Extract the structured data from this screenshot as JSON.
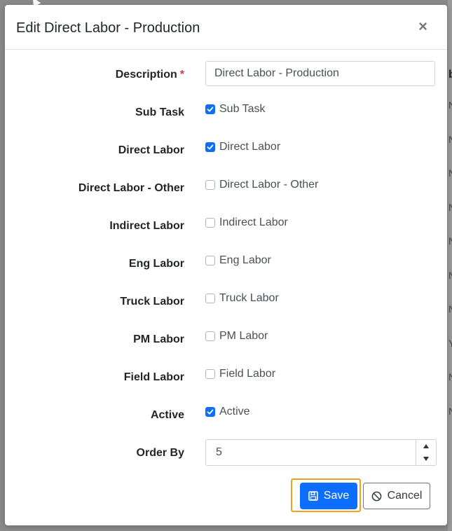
{
  "modal": {
    "title": "Edit Direct Labor - Production",
    "close_glyph": "×"
  },
  "fields": {
    "description": {
      "label": "Description",
      "required_mark": "*",
      "value": "Direct Labor - Production"
    },
    "checkboxes": [
      {
        "label": "Sub Task",
        "option_label": "Sub Task",
        "checked": true
      },
      {
        "label": "Direct Labor",
        "option_label": "Direct Labor",
        "checked": true
      },
      {
        "label": "Direct Labor - Other",
        "option_label": "Direct Labor - Other",
        "checked": false
      },
      {
        "label": "Indirect Labor",
        "option_label": "Indirect Labor",
        "checked": false
      },
      {
        "label": "Eng Labor",
        "option_label": "Eng Labor",
        "checked": false
      },
      {
        "label": "Truck Labor",
        "option_label": "Truck Labor",
        "checked": false
      },
      {
        "label": "PM Labor",
        "option_label": "PM Labor",
        "checked": false
      },
      {
        "label": "Field Labor",
        "option_label": "Field Labor",
        "checked": false
      },
      {
        "label": "Active",
        "option_label": "Active",
        "checked": true
      }
    ],
    "order_by": {
      "label": "Order By",
      "value": "5"
    }
  },
  "buttons": {
    "save_label": "Save",
    "cancel_label": "Cancel"
  },
  "colors": {
    "primary": "#0d6efd",
    "focus_ring": "#f0a020",
    "required": "#dc3545"
  },
  "background_peek": {
    "heading_char": "b",
    "row_chars": [
      "N",
      "N",
      "N",
      "N",
      "N",
      "N",
      "N",
      "Y",
      "N",
      "N"
    ]
  }
}
